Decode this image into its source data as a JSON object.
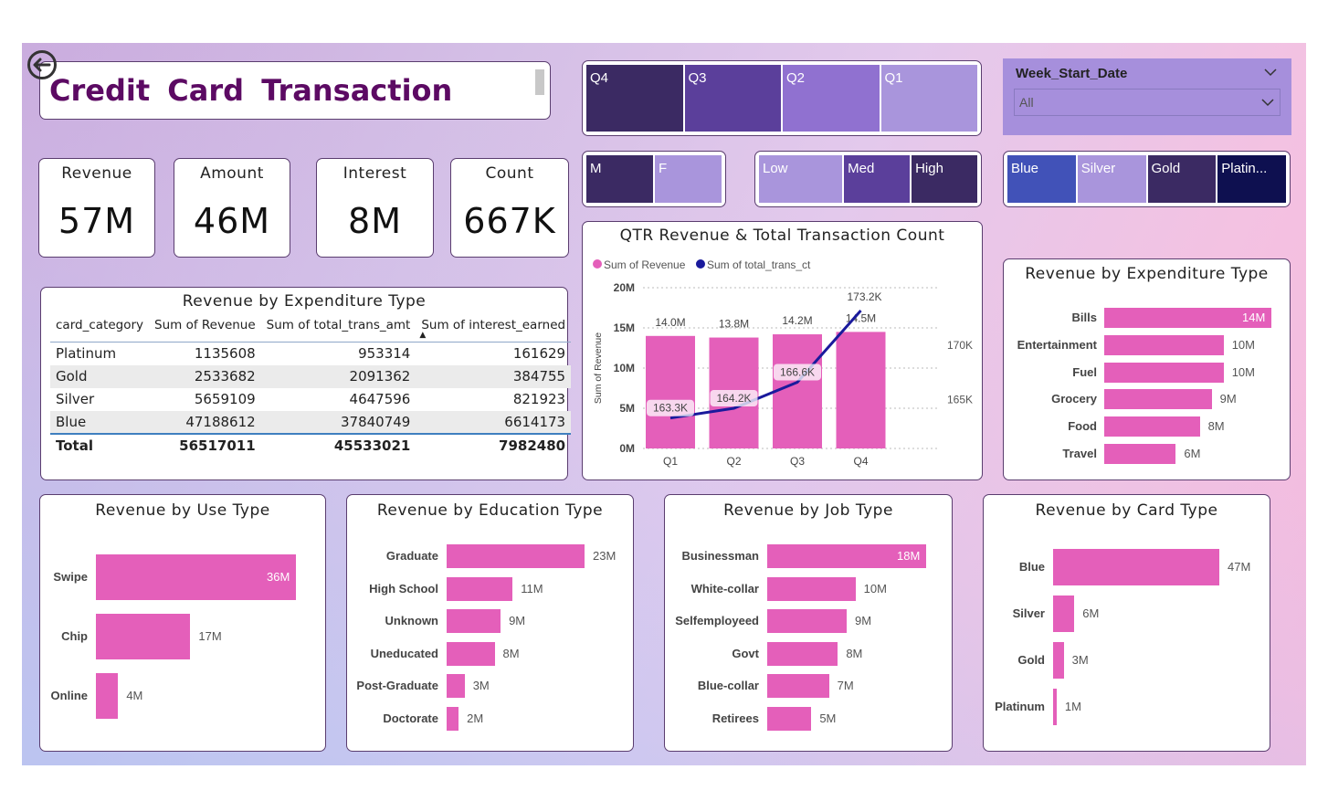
{
  "title": "Credit  Card  Transaction",
  "kpis": [
    {
      "label": "Revenue",
      "value": "57M"
    },
    {
      "label": "Amount",
      "value": "46M"
    },
    {
      "label": "Interest",
      "value": "8M"
    },
    {
      "label": "Count",
      "value": "667K"
    }
  ],
  "slicers": {
    "quarter": [
      "Q4",
      "Q3",
      "Q2",
      "Q1"
    ],
    "gender": [
      "M",
      "F"
    ],
    "income": [
      "Low",
      "Med",
      "High"
    ],
    "card": [
      "Blue",
      "Silver",
      "Gold",
      "Platin..."
    ],
    "week": {
      "label": "Week_Start_Date",
      "value": "All"
    }
  },
  "colors": {
    "bar": "#e45fba",
    "line": "#1a1a9c",
    "title": "#5c0a63"
  },
  "table": {
    "title": "Revenue by Expenditure Type",
    "headers": [
      "card_category",
      "Sum of Revenue",
      "Sum of total_trans_amt",
      "Sum of interest_earned"
    ],
    "rows": [
      [
        "Platinum",
        "1135608",
        "953314",
        "161629"
      ],
      [
        "Gold",
        "2533682",
        "2091362",
        "384755"
      ],
      [
        "Silver",
        "5659109",
        "4647596",
        "821923"
      ],
      [
        "Blue",
        "47188612",
        "37840749",
        "6614173"
      ]
    ],
    "total": [
      "Total",
      "56517011",
      "45533021",
      "7982480"
    ]
  },
  "combo": {
    "title": "QTR Revenue & Total Transaction Count",
    "legend": [
      "Sum of Revenue",
      "Sum of total_trans_ct"
    ],
    "ylabel": "Sum of Revenue",
    "y_ticks": [
      "20M",
      "15M",
      "10M",
      "5M",
      "0M"
    ],
    "y2_ticks": [
      "170K",
      "165K"
    ],
    "bar_labels": [
      "14.0M",
      "13.8M",
      "14.2M",
      "14.5M"
    ],
    "line_labels": [
      "163.3K",
      "164.2K",
      "166.6K",
      "173.2K"
    ]
  },
  "chart_data": [
    {
      "type": "bar",
      "title": "QTR Revenue & Total Transaction Count",
      "categories": [
        "Q1",
        "Q2",
        "Q3",
        "Q4"
      ],
      "series": [
        {
          "name": "Sum of Revenue",
          "values": [
            14.0,
            13.8,
            14.2,
            14.5
          ],
          "unit": "M"
        },
        {
          "name": "Sum of total_trans_ct",
          "values": [
            163.3,
            164.2,
            166.6,
            173.2
          ],
          "unit": "K"
        }
      ],
      "ylim": [
        0,
        20
      ]
    },
    {
      "type": "bar",
      "title": "Revenue by Expenditure Type",
      "categories": [
        "Bills",
        "Entertainment",
        "Fuel",
        "Grocery",
        "Food",
        "Travel"
      ],
      "values": [
        14,
        10,
        10,
        9,
        8,
        6
      ],
      "labels": [
        "14M",
        "10M",
        "10M",
        "9M",
        "8M",
        "6M"
      ]
    },
    {
      "type": "bar",
      "title": "Revenue by Use Type",
      "categories": [
        "Swipe",
        "Chip",
        "Online"
      ],
      "values": [
        36,
        17,
        4
      ],
      "labels": [
        "36M",
        "17M",
        "4M"
      ]
    },
    {
      "type": "bar",
      "title": "Revenue by Education Type",
      "categories": [
        "Graduate",
        "High School",
        "Unknown",
        "Uneducated",
        "Post-Graduate",
        "Doctorate"
      ],
      "values": [
        23,
        11,
        9,
        8,
        3,
        2
      ],
      "labels": [
        "23M",
        "11M",
        "9M",
        "8M",
        "3M",
        "2M"
      ]
    },
    {
      "type": "bar",
      "title": "Revenue by Job Type",
      "categories": [
        "Businessman",
        "White-collar",
        "Selfemployeed",
        "Govt",
        "Blue-collar",
        "Retirees"
      ],
      "values": [
        18,
        10,
        9,
        8,
        7,
        5
      ],
      "labels": [
        "18M",
        "10M",
        "9M",
        "8M",
        "7M",
        "5M"
      ]
    },
    {
      "type": "bar",
      "title": "Revenue by Card Type",
      "categories": [
        "Blue",
        "Silver",
        "Gold",
        "Platinum"
      ],
      "values": [
        47,
        6,
        3,
        1
      ],
      "labels": [
        "47M",
        "6M",
        "3M",
        "1M"
      ]
    }
  ]
}
